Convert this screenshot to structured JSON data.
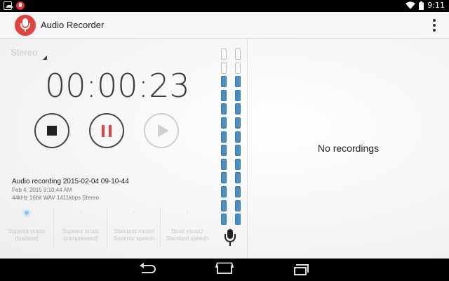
{
  "status_bar": {
    "time": "9:11",
    "icons": [
      "image-notification-icon",
      "recorder-notification-icon",
      "wifi-icon",
      "battery-icon"
    ]
  },
  "app_bar": {
    "title": "Audio Recorder",
    "logo_icon": "microphone-icon",
    "menu_icon": "overflow-menu-icon",
    "accent_color": "#e0423d"
  },
  "recorder": {
    "mode": "Stereo",
    "timer": "00:00:23",
    "controls": {
      "stop_icon": "stop-icon",
      "pause_icon": "pause-icon",
      "play_icon": "play-icon"
    },
    "current_recording": {
      "name": "Audio recording 2015-02-04 09-10-44",
      "date": "Feb 4, 2015 9:10:44 AM",
      "format": "44kHz 16bit WAV 1411kbps Stereo"
    },
    "quality_options": [
      {
        "line1": "Superior music",
        "line2": "(lossless)",
        "selected": true
      },
      {
        "line1": "Superior music",
        "line2": "(compressed)",
        "selected": false
      },
      {
        "line1": "Standard music/",
        "line2": "Superior speech",
        "selected": false
      },
      {
        "line1": "Basic music/",
        "line2": "Standard speech",
        "selected": false
      }
    ],
    "level_meters": {
      "total_segments": 13,
      "left_active": 11,
      "right_active": 11,
      "active_color": "#4a8ec4"
    },
    "mic_icon": "microphone-icon"
  },
  "recordings_pane": {
    "empty_message": "No recordings"
  },
  "nav_bar": {
    "icons": [
      "back-icon",
      "home-icon",
      "recents-icon"
    ]
  }
}
